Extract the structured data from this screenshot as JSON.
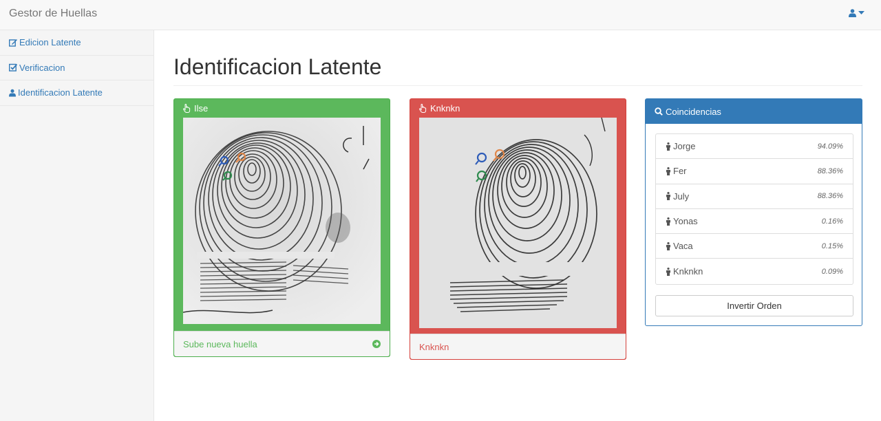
{
  "navbar": {
    "brand": "Gestor de Huellas",
    "user_icon": "user-icon",
    "caret_icon": "caret-down-icon"
  },
  "sidebar": {
    "items": [
      {
        "label": "Edicion Latente",
        "icon": "edit-icon"
      },
      {
        "label": "Verificacion",
        "icon": "check-square-icon"
      },
      {
        "label": "Identificacion Latente",
        "icon": "user-icon"
      }
    ]
  },
  "page": {
    "title": "Identificacion Latente"
  },
  "latent_panel": {
    "title": "Ilse",
    "icon": "hand-pointer-icon",
    "footer_label": "Sube nueva huella",
    "footer_icon": "arrow-circle-right-icon",
    "color": "#5cb85c"
  },
  "match_panel": {
    "title": "Knknkn",
    "icon": "hand-pointer-icon",
    "footer_label": "Knknkn",
    "color": "#d9534f"
  },
  "matches_panel": {
    "title": "Coincidencias",
    "icon": "search-icon",
    "color": "#337ab7",
    "items": [
      {
        "name": "Jorge",
        "score": "94.09%"
      },
      {
        "name": "Fer",
        "score": "88.36%"
      },
      {
        "name": "July",
        "score": "88.36%"
      },
      {
        "name": "Yonas",
        "score": "0.16%"
      },
      {
        "name": "Vaca",
        "score": "0.15%"
      },
      {
        "name": "Knknkn",
        "score": "0.09%"
      }
    ],
    "item_icon": "male-icon",
    "invert_button": "Invertir Orden"
  },
  "minutiae_colors": [
    "#2e5cb8",
    "#e0874a",
    "#2e8b4e"
  ]
}
